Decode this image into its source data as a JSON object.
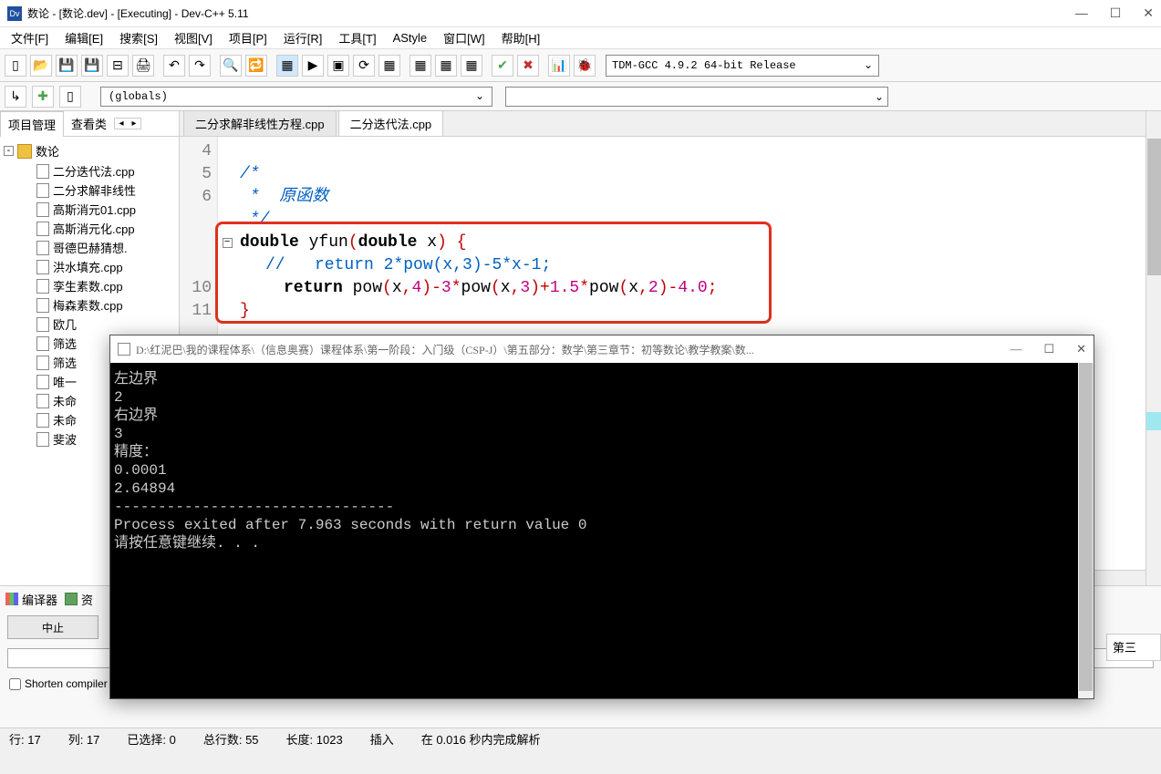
{
  "title": "数论 - [数论.dev] - [Executing] - Dev-C++ 5.11",
  "menu": {
    "file": "文件[F]",
    "edit": "编辑[E]",
    "search": "搜索[S]",
    "view": "视图[V]",
    "project": "项目[P]",
    "run": "运行[R]",
    "tools": "工具[T]",
    "astyle": "AStyle",
    "window": "窗口[W]",
    "help": "帮助[H]"
  },
  "compiler_select": "TDM-GCC 4.9.2 64-bit Release",
  "globals_select": "(globals)",
  "sidebar": {
    "tab_project": "项目管理",
    "tab_classes": "查看类",
    "root": "数论",
    "files": [
      "二分迭代法.cpp",
      "二分求解非线性",
      "高斯消元01.cpp",
      "高斯消元化.cpp",
      "哥德巴赫猜想.",
      "洪水填充.cpp",
      "孪生素数.cpp",
      "梅森素数.cpp",
      "欧几",
      "筛选",
      "筛选",
      "唯一",
      "未命",
      "未命",
      "斐波"
    ]
  },
  "editor": {
    "tabs": [
      {
        "label": "二分求解非线性方程.cpp",
        "active": false
      },
      {
        "label": "二分迭代法.cpp",
        "active": true
      }
    ],
    "line_numbers": [
      "4",
      "5",
      "6",
      "",
      "",
      "",
      "10",
      "11"
    ],
    "code": {
      "l4": "",
      "l5": "/*",
      "l6": " *  原函数",
      "l7": " */",
      "l8_kw1": "double",
      "l8_fn": " yfun",
      "l8_paren1": "(",
      "l8_kw2": "double",
      "l8_x": " x",
      "l8_paren2": ")",
      "l8_brace": " {",
      "l9_cmt": "//   return 2*pow(x,3)-5*x-1;",
      "l10_ret": "return",
      "l10_rest": " pow(x,4)-3*pow(x,3)+1.5*pow(x,2)-4.0;",
      "l11": "}"
    }
  },
  "console": {
    "title": "D:\\红泥巴\\我的课程体系\\（信息奥赛）课程体系\\第一阶段：入门级（CSP-J）\\第五部分：数学\\第三章节：初等数论\\教学教案\\数...",
    "body": "左边界\n2\n右边界\n3\n精度：\n0.0001\n2.64894\n--------------------------------\nProcess exited after 7.963 seconds with return value 0\n请按任意键继续. . ."
  },
  "bottom": {
    "tab_compiler": "编译器",
    "tab_resources": "资",
    "abort": "中止",
    "shorten": "Shorten compiler paths"
  },
  "status": {
    "line": "行:   17",
    "col": "列:   17",
    "sel": "已选择:    0",
    "total": "总行数:   55",
    "length": "长度:   1023",
    "insert": "插入",
    "parse": "在 0.016 秒内完成解析"
  },
  "truncated_tab": "第三"
}
